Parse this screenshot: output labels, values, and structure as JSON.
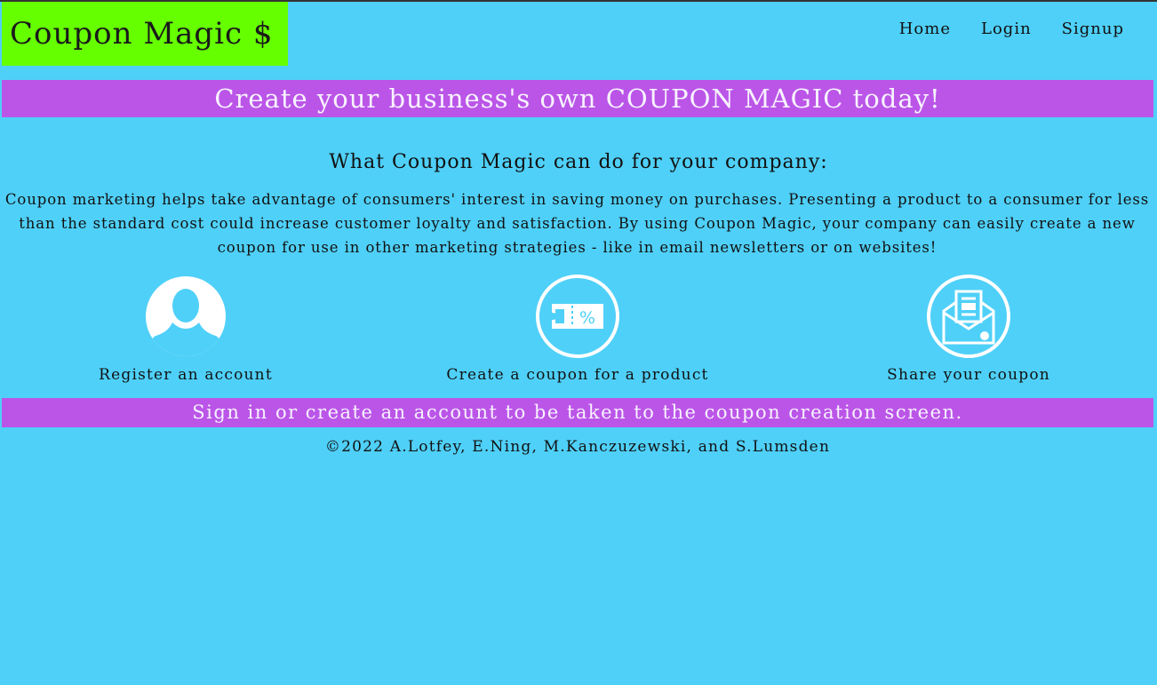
{
  "header": {
    "logo": "Coupon Magic $",
    "nav": [
      "Home",
      "Login",
      "Signup"
    ]
  },
  "banner_top": "Create your business's own COUPON MAGIC today!",
  "section_title": "What Coupon Magic can do for your company:",
  "intro": "Coupon marketing helps take advantage of consumers' interest in saving money on purchases. Presenting a product to a consumer for less than the standard cost could increase customer loyalty and satisfaction. By using Coupon Magic, your company can easily create a new coupon for use in other marketing strategies - like in email newsletters or on websites!",
  "features": [
    {
      "icon": "user-icon",
      "label": "Register an account"
    },
    {
      "icon": "coupon-icon",
      "label": "Create a coupon for a product"
    },
    {
      "icon": "envelope-icon",
      "label": "Share your coupon"
    }
  ],
  "banner_bottom": "Sign in or create an account to be taken to the coupon creation screen.",
  "footer": "©2022 A.Lotfey, E.Ning, M.Kanczuzewski, and S.Lumsden",
  "colors": {
    "background": "#4fd0f8",
    "logo_bg": "#66ff00",
    "banner_bg": "#bb55e8"
  }
}
